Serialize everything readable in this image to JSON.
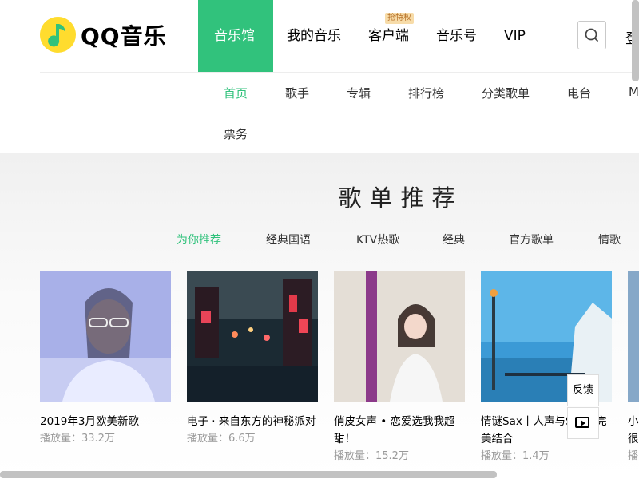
{
  "brand": {
    "name": "QQ音乐",
    "logo_icon": "music-note-logo-icon",
    "accent": "#31c27c"
  },
  "main_nav": {
    "items": [
      {
        "label": "音乐馆",
        "active": true
      },
      {
        "label": "我的音乐"
      },
      {
        "label": "客户端",
        "badge": "抢特权"
      },
      {
        "label": "音乐号"
      },
      {
        "label": "VIP"
      }
    ]
  },
  "header": {
    "search_icon": "search-icon",
    "login_label": "登"
  },
  "sub_nav": {
    "items": [
      "首页",
      "歌手",
      "专辑",
      "排行榜",
      "分类歌单",
      "电台",
      "M",
      "票务"
    ],
    "active_index": 0
  },
  "playlist_section": {
    "title": "歌单推荐",
    "tabs": [
      "为你推荐",
      "经典国语",
      "KTV热歌",
      "经典",
      "官方歌单",
      "情歌"
    ],
    "active_tab_index": 0,
    "cards": [
      {
        "title": "2019年3月欧美新歌",
        "plays": "播放量：33.2万"
      },
      {
        "title": "电子 · 来自东方的神秘派对",
        "plays": "播放量：6.6万"
      },
      {
        "title": "俏皮女声 • 恋爱选我我超甜！",
        "plays": "播放量：15.2万"
      },
      {
        "title": "情谜Sax丨人声与Sax的完美结合",
        "plays": "播放量：1.4万"
      },
      {
        "title": "小很",
        "plays": "播"
      }
    ]
  },
  "floating": {
    "feedback_label": "反馈",
    "player_icon": "play-box-icon"
  }
}
